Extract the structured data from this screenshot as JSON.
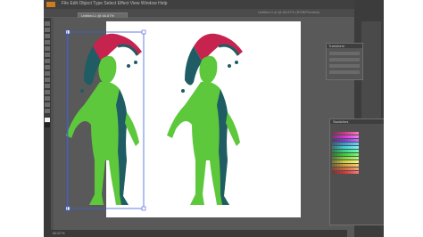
{
  "app": {
    "menu_text": "File  Edit  Object  Type  Select  Effect  View  Window  Help",
    "doc_tab_label": "Untitled-1 @ 66.67%",
    "title_text": "Untitled-1.ai @ 66.67% (RGB/Preview)",
    "status_text": "66.67%"
  },
  "panels": {
    "properties_title": "Transform",
    "swatches_title": "Swatches"
  },
  "colors": {
    "figure_green": "#5ec83c",
    "figure_shadow": "#1f5c63",
    "hat_red": "#c6244e",
    "hat_teal": "#1f5c63",
    "selection_blue": "#3f5fd8"
  },
  "icons": {
    "app_logo": "illustrator-logo-icon",
    "tools": "tool-icon"
  }
}
